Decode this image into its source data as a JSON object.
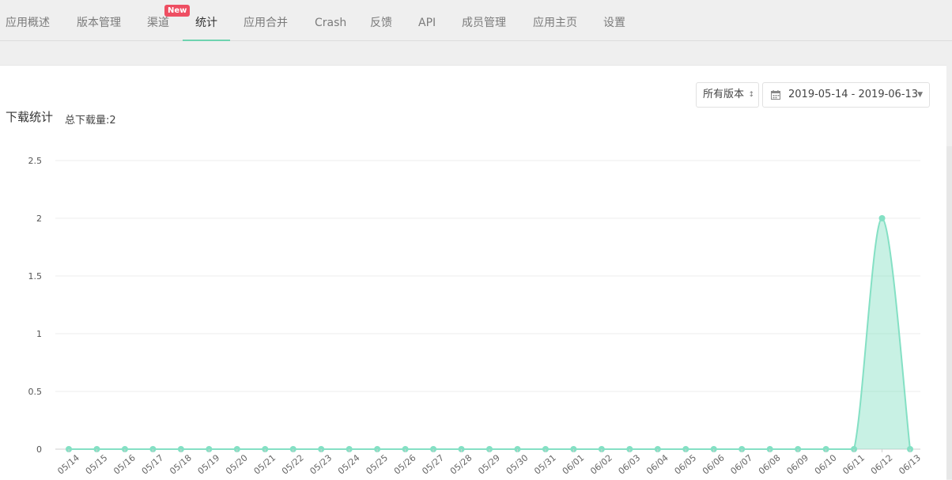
{
  "nav": {
    "tabs": [
      {
        "label": "应用概述"
      },
      {
        "label": "版本管理"
      },
      {
        "label": "渠道",
        "badge": "New"
      },
      {
        "label": "统计",
        "active": true
      },
      {
        "label": "应用合并"
      },
      {
        "label": "Crash"
      },
      {
        "label": "反馈"
      },
      {
        "label": "API"
      },
      {
        "label": "成员管理"
      },
      {
        "label": "应用主页"
      },
      {
        "label": "设置"
      }
    ]
  },
  "filters": {
    "version": "所有版本",
    "date_range": "2019-05-14 - 2019-06-13",
    "calendar_icon": "calendar-icon"
  },
  "stats": {
    "title": "下载统计",
    "total_label": "总下载量:2"
  },
  "chart_data": {
    "type": "area",
    "title": "",
    "xlabel": "",
    "ylabel": "",
    "ylim": [
      0,
      2.5
    ],
    "y_ticks": [
      "0",
      "0.5",
      "1",
      "1.5",
      "2",
      "2.5"
    ],
    "grid": true,
    "color": "#84e0c4",
    "categories": [
      "05/14",
      "05/15",
      "05/16",
      "05/17",
      "05/18",
      "05/19",
      "05/20",
      "05/21",
      "05/22",
      "05/23",
      "05/24",
      "05/25",
      "05/26",
      "05/27",
      "05/28",
      "05/29",
      "05/30",
      "05/31",
      "06/01",
      "06/02",
      "06/03",
      "06/04",
      "06/05",
      "06/06",
      "06/07",
      "06/08",
      "06/09",
      "06/10",
      "06/11",
      "06/12",
      "06/13"
    ],
    "values": [
      0,
      0,
      0,
      0,
      0,
      0,
      0,
      0,
      0,
      0,
      0,
      0,
      0,
      0,
      0,
      0,
      0,
      0,
      0,
      0,
      0,
      0,
      0,
      0,
      0,
      0,
      0,
      0,
      0,
      2,
      0
    ]
  }
}
